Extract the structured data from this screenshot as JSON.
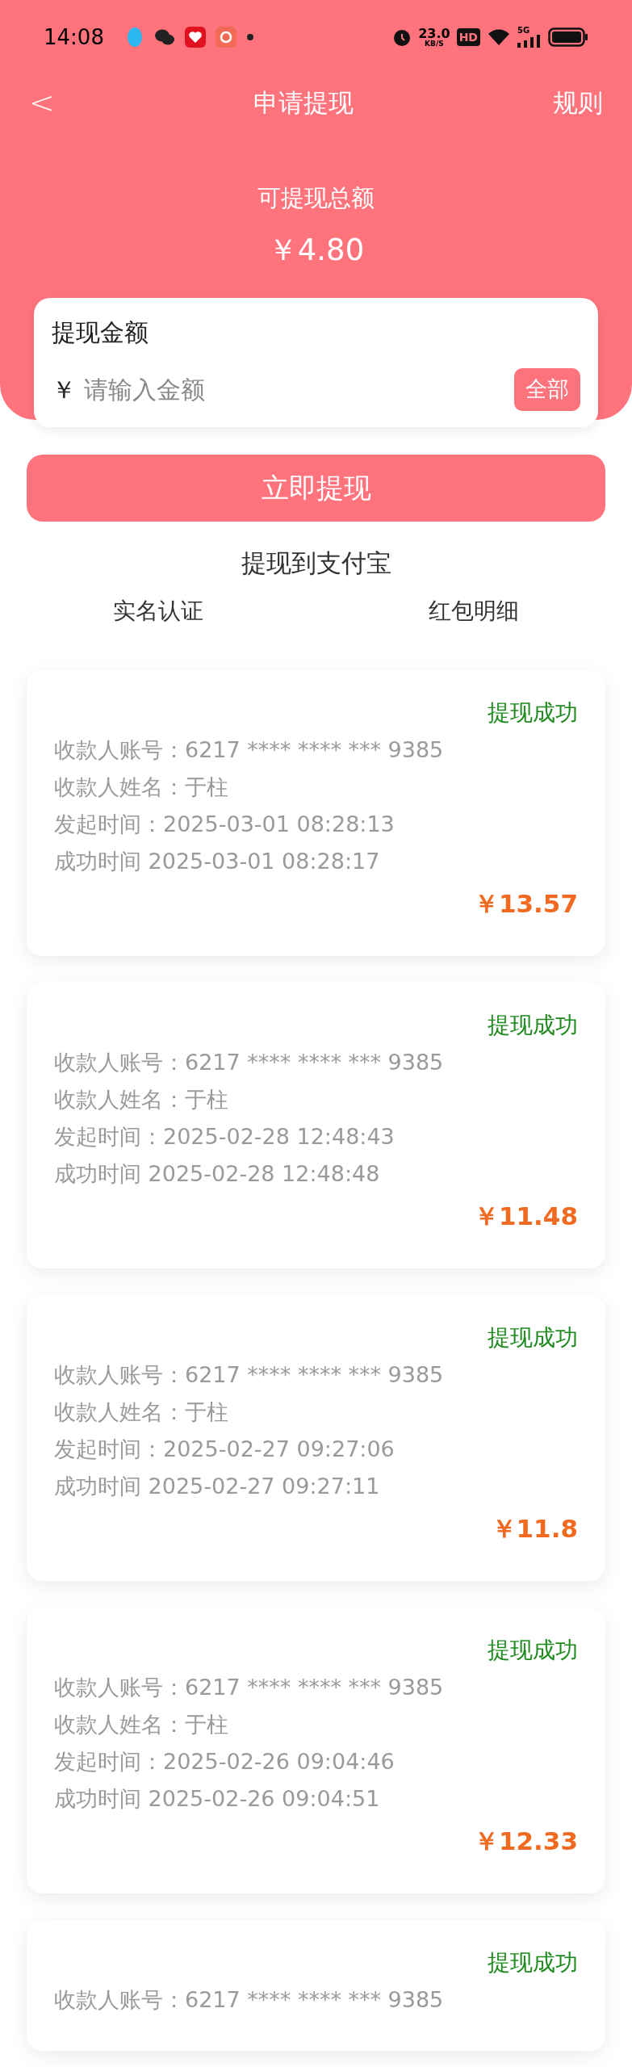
{
  "status_bar": {
    "time": "14:08",
    "speed": "23.0",
    "speed_unit": "KB/S",
    "hd": "HD",
    "network": "5G"
  },
  "nav": {
    "back": "<",
    "title": "申请提现",
    "rules": "规则"
  },
  "balance": {
    "label": "可提现总额",
    "amount": "￥4.80"
  },
  "amount_card": {
    "label": "提现金额",
    "currency": "￥",
    "placeholder": "请输入金额",
    "all_button": "全部"
  },
  "submit_button": "立即提现",
  "destination": "提现到支付宝",
  "links": [
    "实名认证",
    "红包明细"
  ],
  "records": [
    {
      "status": "提现成功",
      "account": "收款人账号：6217 **** **** *** 9385",
      "name": "收款人姓名：于柱",
      "start": "发起时间：2025-03-01 08:28:13",
      "success": "成功时间 2025-03-01 08:28:17",
      "amount": "￥13.57"
    },
    {
      "status": "提现成功",
      "account": "收款人账号：6217 **** **** *** 9385",
      "name": "收款人姓名：于柱",
      "start": "发起时间：2025-02-28 12:48:43",
      "success": "成功时间 2025-02-28 12:48:48",
      "amount": "￥11.48"
    },
    {
      "status": "提现成功",
      "account": "收款人账号：6217 **** **** *** 9385",
      "name": "收款人姓名：于柱",
      "start": "发起时间：2025-02-27 09:27:06",
      "success": "成功时间 2025-02-27 09:27:11",
      "amount": "￥11.8"
    },
    {
      "status": "提现成功",
      "account": "收款人账号：6217 **** **** *** 9385",
      "name": "收款人姓名：于柱",
      "start": "发起时间：2025-02-26 09:04:46",
      "success": "成功时间 2025-02-26 09:04:51",
      "amount": "￥12.33"
    },
    {
      "status": "提现成功",
      "account": "收款人账号：6217 **** **** *** 9385"
    }
  ]
}
